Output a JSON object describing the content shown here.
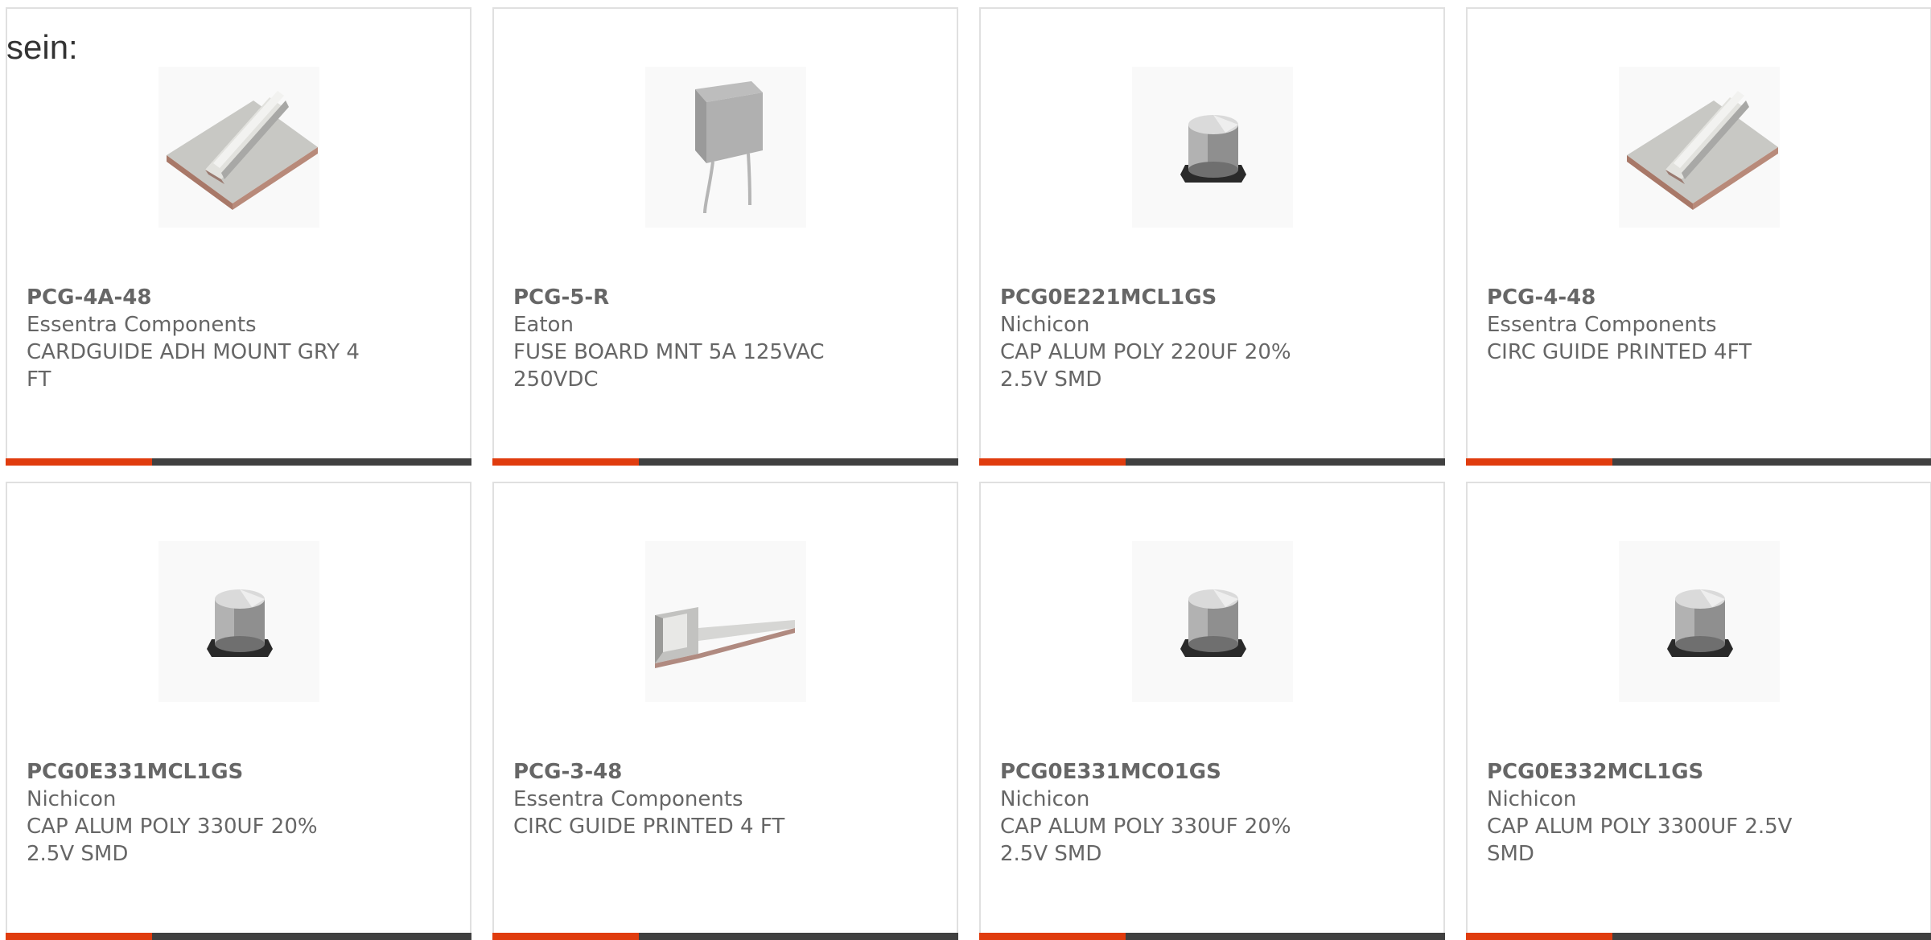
{
  "heading": "sein:",
  "colors": {
    "accent": "#e03c0e",
    "bar": "#404040",
    "text": "#666666",
    "border": "#e0e0e0"
  },
  "products": [
    {
      "part_number": "PCG-4A-48",
      "manufacturer": "Essentra Components",
      "description": "CARDGUIDE ADH MOUNT GRY 4 FT",
      "image": "card-guide-adhesive"
    },
    {
      "part_number": "PCG-5-R",
      "manufacturer": "Eaton",
      "description": "FUSE BOARD MNT 5A 125VAC 250VDC",
      "image": "radial-fuse"
    },
    {
      "part_number": "PCG0E221MCL1GS",
      "manufacturer": "Nichicon",
      "description": "CAP ALUM POLY 220UF 20% 2.5V SMD",
      "image": "smd-capacitor"
    },
    {
      "part_number": "PCG-4-48",
      "manufacturer": "Essentra Components",
      "description": "CIRC GUIDE PRINTED 4FT",
      "image": "card-guide-adhesive"
    },
    {
      "part_number": "PCG0E331MCL1GS",
      "manufacturer": "Nichicon",
      "description": "CAP ALUM POLY 330UF 20% 2.5V SMD",
      "image": "smd-capacitor"
    },
    {
      "part_number": "PCG-3-48",
      "manufacturer": "Essentra Components",
      "description": "CIRC GUIDE PRINTED 4 FT",
      "image": "card-guide-flat"
    },
    {
      "part_number": "PCG0E331MCO1GS",
      "manufacturer": "Nichicon",
      "description": "CAP ALUM POLY 330UF 20% 2.5V SMD",
      "image": "smd-capacitor"
    },
    {
      "part_number": "PCG0E332MCL1GS",
      "manufacturer": "Nichicon",
      "description": "CAP ALUM POLY 3300UF 2.5V SMD",
      "image": "smd-capacitor"
    }
  ]
}
